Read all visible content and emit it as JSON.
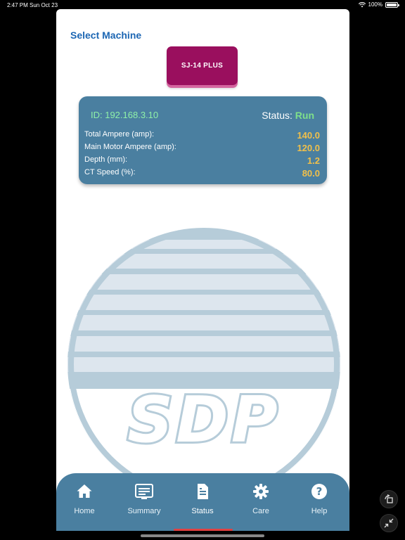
{
  "statusbar": {
    "time": "2:47 PM",
    "date": "Sun Oct 23",
    "battery": "100%",
    "battery_level": 1.0
  },
  "page": {
    "title": "Select Machine"
  },
  "machine": {
    "label": "SJ-14 PLUS"
  },
  "card": {
    "ip_label": "ID: 192.168.3.10",
    "status_label": "Status:",
    "status_value": "Run",
    "rows": [
      {
        "label": "Total Ampere (amp):",
        "value": "140.0"
      },
      {
        "label": "Main Motor Ampere (amp):",
        "value": "120.0"
      },
      {
        "label": "Depth (mm):",
        "value": "1.2"
      },
      {
        "label": "CT Speed (%):",
        "value": "80.0"
      }
    ]
  },
  "logo": {
    "text": "SDP"
  },
  "nav": {
    "items": [
      {
        "label": "Home",
        "icon": "home-icon"
      },
      {
        "label": "Summary",
        "icon": "summary-icon"
      },
      {
        "label": "Status",
        "icon": "status-icon",
        "active": true
      },
      {
        "label": "Care",
        "icon": "gear-icon"
      },
      {
        "label": "Help",
        "icon": "help-icon"
      }
    ]
  },
  "colors": {
    "accent": "#1c66b3",
    "machine_button": "#9a0f5e",
    "card": "#4a7fa0",
    "status_run": "#7fe08a",
    "value": "#f1c04a"
  }
}
